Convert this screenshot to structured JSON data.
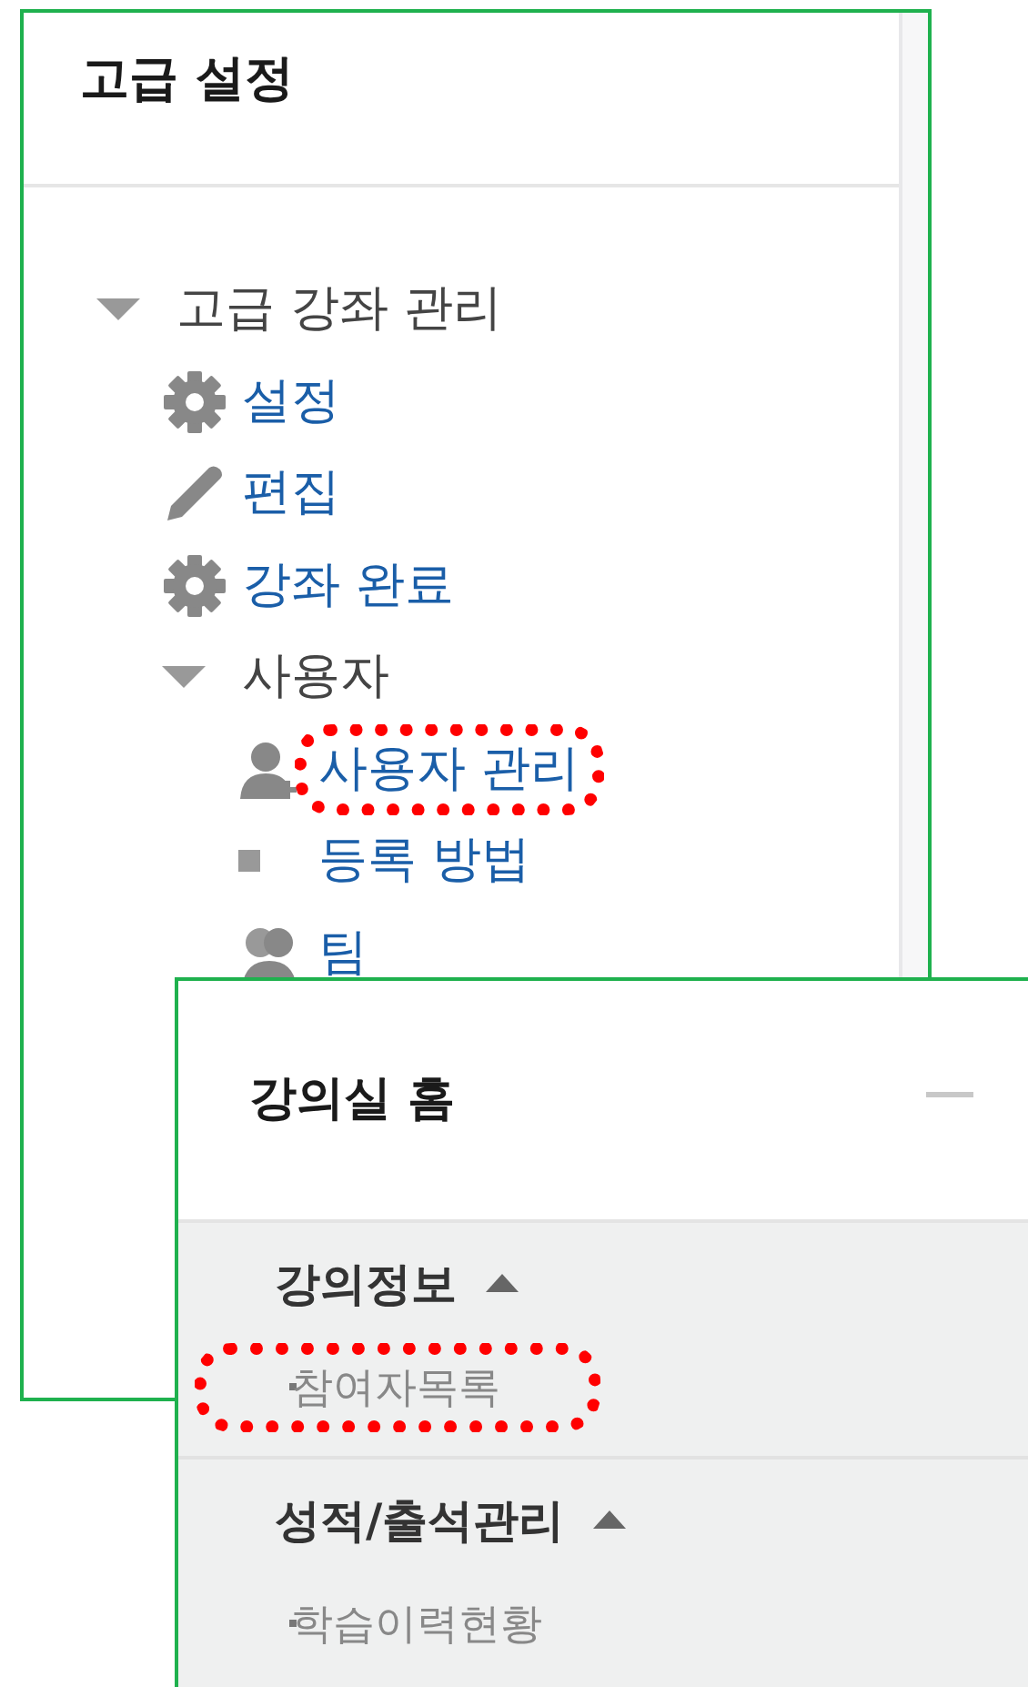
{
  "settings_panel": {
    "title": "고급 설정",
    "tree": [
      {
        "label": "고급 강좌 관리",
        "expanded": true,
        "highlighted": false,
        "children": [
          {
            "label": "설정",
            "kind": "gear",
            "highlighted": false
          },
          {
            "label": "편집",
            "kind": "pencil",
            "highlighted": false
          },
          {
            "label": "강좌 완료",
            "kind": "gear",
            "highlighted": false
          },
          {
            "label": "사용자",
            "kind": "folder",
            "expanded": true,
            "highlighted": false,
            "children": [
              {
                "label": "사용자 관리",
                "kind": "user-add",
                "highlighted": true
              },
              {
                "label": "등록 방법",
                "kind": "square",
                "highlighted": false
              },
              {
                "label": "팀",
                "kind": "group",
                "highlighted": false
              }
            ]
          }
        ]
      }
    ]
  },
  "classroom_panel": {
    "title": "강의실 홈",
    "sections": [
      {
        "label": "강의정보",
        "expanded": true,
        "items": [
          {
            "label": "참여자목록",
            "highlighted": true
          }
        ]
      },
      {
        "label": "성적/출석관리",
        "expanded": true,
        "items": [
          {
            "label": "학습이력현황",
            "highlighted": false
          }
        ]
      }
    ]
  }
}
